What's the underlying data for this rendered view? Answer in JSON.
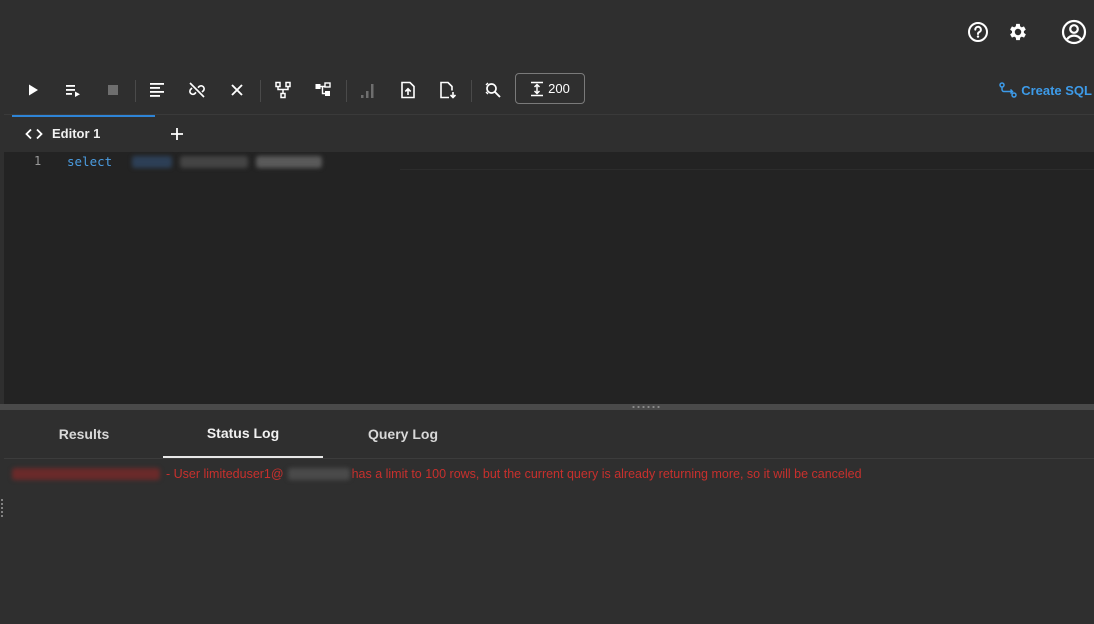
{
  "header": {
    "icons": [
      "help-icon",
      "settings-icon",
      "account-icon"
    ]
  },
  "toolbar": {
    "limit_value": "200",
    "create_sql_label": "Create SQL",
    "accent": "#3d9be9",
    "buttons": [
      "run-icon",
      "run-script-icon",
      "stop-icon",
      "format-icon",
      "unlink-icon",
      "clear-icon",
      "explain-plan-icon",
      "execution-plan-icon",
      "chart-icon",
      "upload-icon",
      "download-icon",
      "search-replace-icon",
      "limit-icon"
    ]
  },
  "editor": {
    "tab_label": "Editor 1",
    "line_number": "1",
    "keyword": "select"
  },
  "bottom": {
    "tabs": [
      "Results",
      "Status Log",
      "Query Log"
    ],
    "active_tab": "Status Log",
    "log": {
      "message_part1": "- User limiteduser1@",
      "message_part2": " has a limit to 100 rows, but the current query is already returning more, so it will be canceled",
      "color": "#c8302d"
    }
  }
}
